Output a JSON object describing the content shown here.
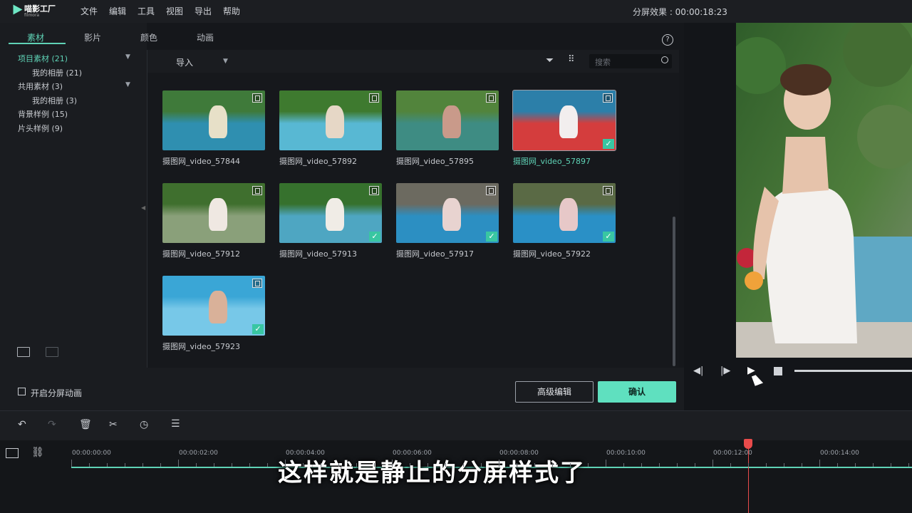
{
  "app": {
    "logo_text": "喵影工厂",
    "logo_sub": "filmora"
  },
  "menu": [
    "文件",
    "编辑",
    "工具",
    "视图",
    "导出",
    "帮助"
  ],
  "split_effect": {
    "label": "分屏效果 : 00:00:18:23"
  },
  "tabs": [
    "素材",
    "影片",
    "颜色",
    "动画"
  ],
  "tree": [
    {
      "label": "项目素材 (21)",
      "active": true
    },
    {
      "label": "我的相册 (21)"
    },
    {
      "label": "共用素材 (3)"
    },
    {
      "label": "我的相册 (3)"
    },
    {
      "label": "背景样例 (15)"
    },
    {
      "label": "片头样例 (9)"
    }
  ],
  "toolbar": {
    "import_label": "导入",
    "search_placeholder": "搜索"
  },
  "media": [
    {
      "caption": "摄图网_video_57844",
      "checked": false,
      "colors": [
        "#3f7a3a",
        "#2f8fb0",
        "#e7e0c8"
      ]
    },
    {
      "caption": "摄图网_video_57892",
      "checked": false,
      "colors": [
        "#3e7a2f",
        "#58b8d3",
        "#e6d7c6"
      ]
    },
    {
      "caption": "摄图网_video_57895",
      "checked": false,
      "colors": [
        "#52843c",
        "#3e8c83",
        "#c99a8a"
      ]
    },
    {
      "caption": "摄图网_video_57897",
      "checked": true,
      "colors": [
        "#2c7fa9",
        "#d43d3d",
        "#f2eeee"
      ]
    },
    {
      "caption": "摄图网_video_57912",
      "checked": false,
      "colors": [
        "#3f6f2e",
        "#8aa07a",
        "#efe8e2"
      ]
    },
    {
      "caption": "摄图网_video_57913",
      "checked": true,
      "colors": [
        "#36712d",
        "#4ea6c2",
        "#f0ece6"
      ]
    },
    {
      "caption": "摄图网_video_57917",
      "checked": true,
      "colors": [
        "#6c6a60",
        "#2c8fc2",
        "#e8d3d0"
      ]
    },
    {
      "caption": "摄图网_video_57922",
      "checked": true,
      "colors": [
        "#5a6a45",
        "#2a90c6",
        "#e7c8c8"
      ]
    },
    {
      "caption": "摄图网_video_57923",
      "checked": true,
      "colors": [
        "#3aa6d6",
        "#77c8e8",
        "#d9b199"
      ]
    }
  ],
  "bottom": {
    "checkbox_label": "开启分屏动画",
    "advanced_button": "高级编辑",
    "ok_button": "确认"
  },
  "timeline": {
    "ticks": [
      "00:00:00:00",
      "00:00:02:00",
      "00:00:04:00",
      "00:00:06:00",
      "00:00:08:00",
      "00:00:10:00",
      "00:00:12:00",
      "00:00:14:00"
    ]
  },
  "subtitle": "这样就是静止的分屏样式了"
}
